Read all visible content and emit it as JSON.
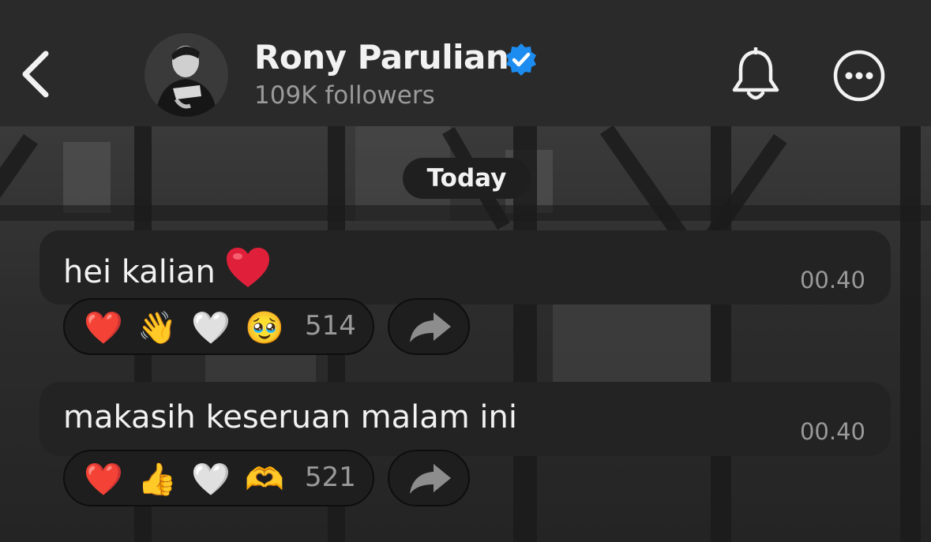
{
  "header": {
    "back_icon": "chevron-left-icon",
    "avatar_alt": "profile photo",
    "name": "Rony Parulian",
    "verified_icon": "verified-badge-icon",
    "followers": "109K followers",
    "bell_icon": "bell-icon",
    "more_icon": "more-options-icon"
  },
  "date_separator": "Today",
  "messages": [
    {
      "text": "hei kalian",
      "emoji": "❤️",
      "time": "00.40",
      "reactions": [
        "❤️",
        "👋",
        "🤍",
        "🥹"
      ],
      "reaction_count": "514"
    },
    {
      "text": "makasih keseruan malam ini",
      "time": "00.40",
      "reactions": [
        "❤️",
        "👍",
        "🤍",
        "🫶"
      ],
      "reaction_count": "521"
    }
  ],
  "colors": {
    "header_bg": "#2a2a2a",
    "bubble_bg": "#232323",
    "verified_blue": "#1d8cf0",
    "heart_red": "#e0203a"
  }
}
